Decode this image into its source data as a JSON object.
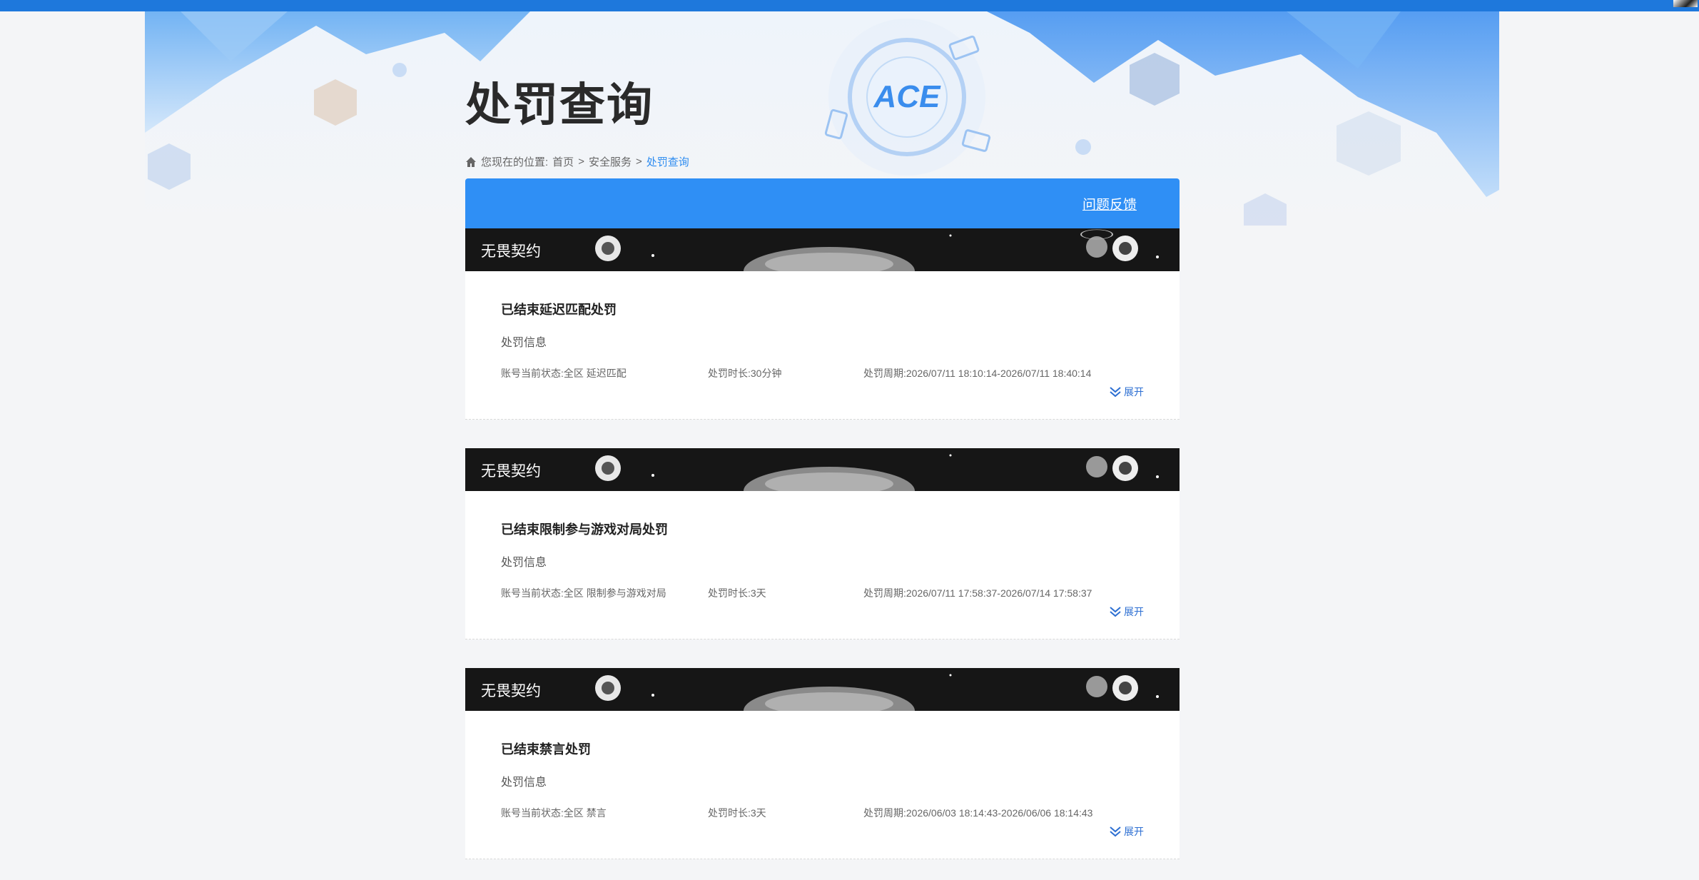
{
  "header": {
    "page_title": "处罚查询",
    "feedback_label": "问题反馈"
  },
  "banner": {
    "logo_text": "ACE"
  },
  "breadcrumb": {
    "prefix": "您现在的位置:",
    "home": "首页",
    "sep": ">",
    "section": "安全服务",
    "current": "处罚查询"
  },
  "cards": [
    {
      "game": "无畏契约",
      "title": "已结束延迟匹配处罚",
      "subtitle": "处罚信息",
      "status": "账号当前状态:全区 延迟匹配",
      "duration": "处罚时长:30分钟",
      "period": "处罚周期:2026/07/11 18:10:14-2026/07/11 18:40:14",
      "expand": "展开"
    },
    {
      "game": "无畏契约",
      "title": "已结束限制参与游戏对局处罚",
      "subtitle": "处罚信息",
      "status": "账号当前状态:全区 限制参与游戏对局",
      "duration": "处罚时长:3天",
      "period": "处罚周期:2026/07/11 17:58:37-2026/07/14 17:58:37",
      "expand": "展开"
    },
    {
      "game": "无畏契约",
      "title": "已结束禁言处罚",
      "subtitle": "处罚信息",
      "status": "账号当前状态:全区 禁言",
      "duration": "处罚时长:3天",
      "period": "处罚周期:2026/06/03 18:14:43-2026/06/06 18:14:43",
      "expand": "展开"
    }
  ],
  "colors": {
    "topbar": "#1e78dc",
    "panel_header": "#2f8ff5",
    "link": "#2d6fd2"
  }
}
